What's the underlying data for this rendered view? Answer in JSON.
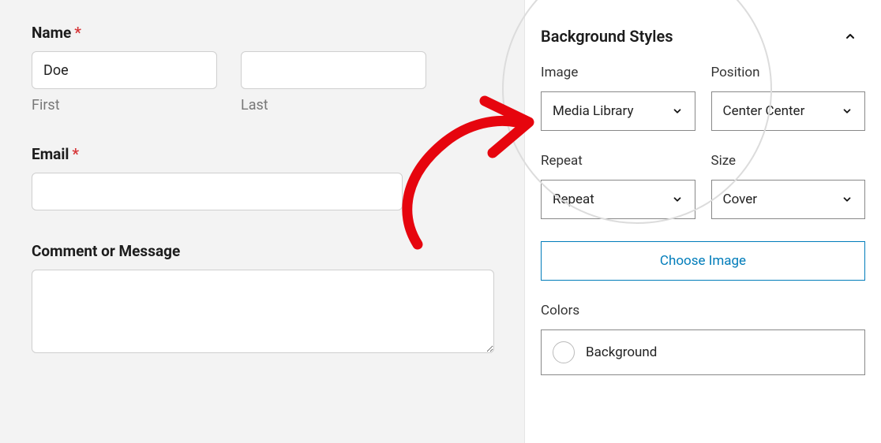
{
  "form": {
    "name_label": "Name",
    "required_mark": "*",
    "first_value": "Doe",
    "first_sublabel": "First",
    "last_value": "",
    "last_sublabel": "Last",
    "email_label": "Email",
    "comment_label": "Comment or Message"
  },
  "sidebar": {
    "panel_title": "Background Styles",
    "image_label": "Image",
    "image_value": "Media Library",
    "position_label": "Position",
    "position_value": "Center Center",
    "repeat_label": "Repeat",
    "repeat_value": "Repeat",
    "size_label": "Size",
    "size_value": "Cover",
    "choose_image_label": "Choose Image",
    "colors_label": "Colors",
    "background_label": "Background"
  }
}
